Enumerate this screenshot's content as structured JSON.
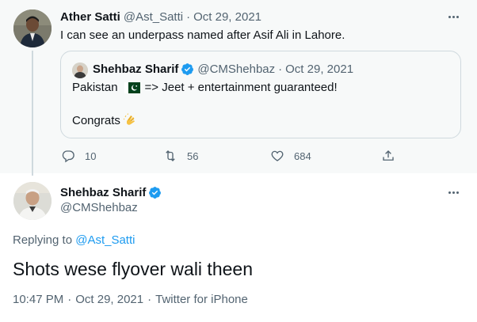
{
  "reply_tweet": {
    "author_name": "Ather Satti",
    "handle": "@Ast_Satti",
    "separator": "·",
    "date": "Oct 29, 2021",
    "text": "I can see an underpass named after Asif Ali in Lahore.",
    "avatar_icon": "user-avatar",
    "quoted_tweet": {
      "author_name": "Shehbaz Sharif",
      "handle": "@CMShehbaz",
      "separator": "·",
      "date": "Oct 29, 2021",
      "line1_start": "Pakistan",
      "line1_flag": "pakistan-flag-emoji",
      "line1_end": "=> Jeet + entertainment guaranteed!",
      "line2": "Congrats",
      "line2_emoji": "clapping-hands-emoji",
      "verified": true
    },
    "actions": {
      "replies": "10",
      "retweets": "56",
      "likes": "684"
    }
  },
  "main_tweet": {
    "author_name": "Shehbaz Sharif",
    "handle": "@CMShehbaz",
    "verified": true,
    "replying_prefix": "Replying to",
    "replying_handle": "@Ast_Satti",
    "text": "Shots wese flyover wali theen",
    "time": "10:47 PM",
    "separator": "·",
    "date": "Oct 29, 2021",
    "source": "Twitter for iPhone"
  },
  "colors": {
    "verified_blue": "#1d9bf0",
    "muted_text": "#536471",
    "link": "#1d9bf0",
    "reply_bg": "#f7f9f9"
  }
}
